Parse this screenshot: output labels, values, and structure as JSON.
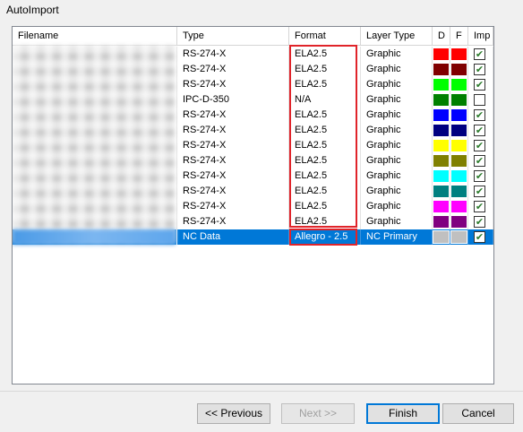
{
  "window": {
    "title": "AutoImport"
  },
  "grid": {
    "headers": [
      "Filename",
      "Type",
      "Format",
      "Layer Type",
      "D",
      "F",
      "Imp"
    ],
    "rows": [
      {
        "type": "RS-274-X",
        "format": "ELA2.5",
        "layer": "Graphic",
        "d": "#ff0000",
        "f": "#ff0000",
        "imp": true,
        "selected": false
      },
      {
        "type": "RS-274-X",
        "format": "ELA2.5",
        "layer": "Graphic",
        "d": "#800000",
        "f": "#800000",
        "imp": true,
        "selected": false
      },
      {
        "type": "RS-274-X",
        "format": "ELA2.5",
        "layer": "Graphic",
        "d": "#00ff00",
        "f": "#00ff00",
        "imp": true,
        "selected": false
      },
      {
        "type": "IPC-D-350",
        "format": "N/A",
        "layer": "Graphic",
        "d": "#008000",
        "f": "#008000",
        "imp": false,
        "selected": false
      },
      {
        "type": "RS-274-X",
        "format": "ELA2.5",
        "layer": "Graphic",
        "d": "#0000ff",
        "f": "#0000ff",
        "imp": true,
        "selected": false
      },
      {
        "type": "RS-274-X",
        "format": "ELA2.5",
        "layer": "Graphic",
        "d": "#000080",
        "f": "#000080",
        "imp": true,
        "selected": false
      },
      {
        "type": "RS-274-X",
        "format": "ELA2.5",
        "layer": "Graphic",
        "d": "#ffff00",
        "f": "#ffff00",
        "imp": true,
        "selected": false
      },
      {
        "type": "RS-274-X",
        "format": "ELA2.5",
        "layer": "Graphic",
        "d": "#808000",
        "f": "#808000",
        "imp": true,
        "selected": false
      },
      {
        "type": "RS-274-X",
        "format": "ELA2.5",
        "layer": "Graphic",
        "d": "#00ffff",
        "f": "#00ffff",
        "imp": true,
        "selected": false
      },
      {
        "type": "RS-274-X",
        "format": "ELA2.5",
        "layer": "Graphic",
        "d": "#008080",
        "f": "#008080",
        "imp": true,
        "selected": false
      },
      {
        "type": "RS-274-X",
        "format": "ELA2.5",
        "layer": "Graphic",
        "d": "#ff00ff",
        "f": "#ff00ff",
        "imp": true,
        "selected": false
      },
      {
        "type": "RS-274-X",
        "format": "ELA2.5",
        "layer": "Graphic",
        "d": "#800080",
        "f": "#800080",
        "imp": true,
        "selected": false
      },
      {
        "type": "NC Data",
        "format": "Allegro - 2.5",
        "layer": "NC Primary",
        "d": "#c0c0c0",
        "f": "#c0c0c0",
        "imp": true,
        "selected": true
      }
    ]
  },
  "buttons": {
    "previous": "<< Previous",
    "next": "Next >>",
    "finish": "Finish",
    "cancel": "Cancel"
  },
  "colors": {
    "selection": "#0078d7",
    "highlight_box": "#e0242a"
  }
}
